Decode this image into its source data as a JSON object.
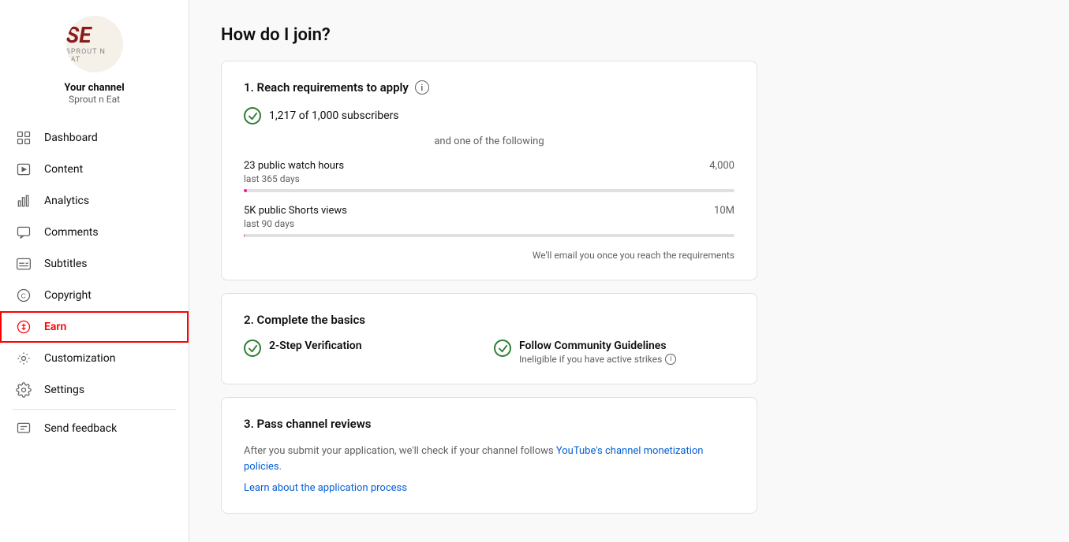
{
  "sidebar": {
    "channel": {
      "name": "Your channel",
      "handle": "Sprout n Eat",
      "logo_text": "SE",
      "logo_subtitle": "SPROUT N EAT"
    },
    "nav_items": [
      {
        "id": "dashboard",
        "label": "Dashboard",
        "icon": "dashboard-icon"
      },
      {
        "id": "content",
        "label": "Content",
        "icon": "content-icon"
      },
      {
        "id": "analytics",
        "label": "Analytics",
        "icon": "analytics-icon"
      },
      {
        "id": "comments",
        "label": "Comments",
        "icon": "comments-icon"
      },
      {
        "id": "subtitles",
        "label": "Subtitles",
        "icon": "subtitles-icon"
      },
      {
        "id": "copyright",
        "label": "Copyright",
        "icon": "copyright-icon"
      },
      {
        "id": "earn",
        "label": "Earn",
        "icon": "earn-icon",
        "active": true
      },
      {
        "id": "customization",
        "label": "Customization",
        "icon": "customization-icon"
      },
      {
        "id": "settings",
        "label": "Settings",
        "icon": "settings-icon"
      },
      {
        "id": "send-feedback",
        "label": "Send feedback",
        "icon": "feedback-icon"
      }
    ]
  },
  "main": {
    "title": "How do I join?",
    "card1": {
      "title": "1. Reach requirements to apply",
      "subscribers_label": "1,217 of 1,000 subscribers",
      "and_separator": "and one of the following",
      "watch_hours": {
        "label": "23 public watch hours",
        "sublabel": "last 365 days",
        "target": "4,000",
        "percent": 0.575
      },
      "shorts_views": {
        "label": "5K public Shorts views",
        "sublabel": "last 90 days",
        "target": "10M",
        "percent": 0.05
      },
      "email_notice": "We'll email you once you reach the requirements"
    },
    "card2": {
      "title": "2. Complete the basics",
      "item1_label": "2-Step Verification",
      "item2_label": "Follow Community Guidelines",
      "item2_sub": "Ineligible if you have active strikes"
    },
    "card3": {
      "title": "3. Pass channel reviews",
      "desc_part1": "After you submit your application, we'll check if your channel follows ",
      "link_label": "YouTube's channel monetization policies",
      "desc_part2": ".",
      "learn_link": "Learn about the application process"
    }
  }
}
